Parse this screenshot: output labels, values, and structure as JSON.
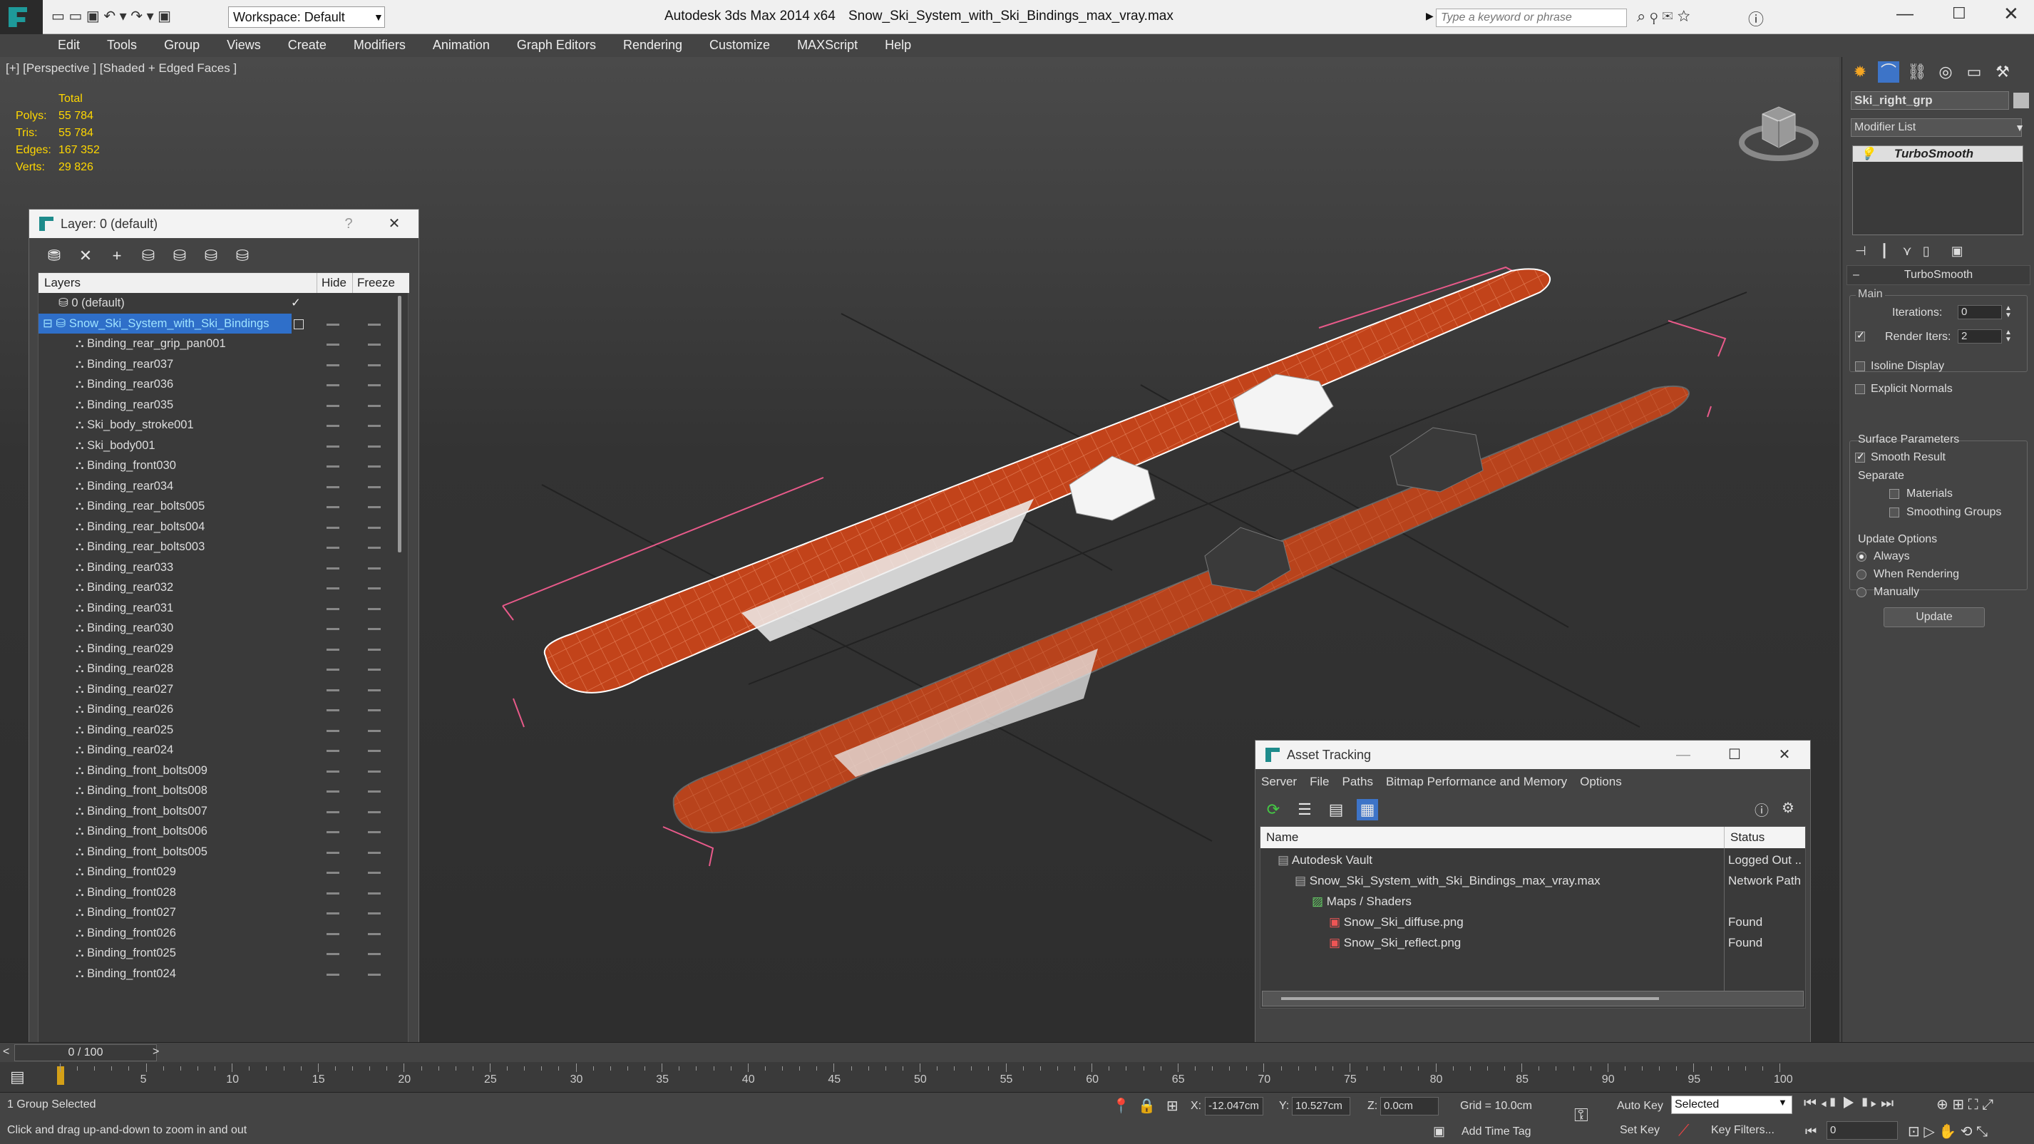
{
  "app": {
    "title": "Autodesk 3ds Max  2014 x64",
    "file": "Snow_Ski_System_with_Ski_Bindings_max_vray.max",
    "workspace": "Workspace: Default",
    "search_placeholder": "Type a keyword or phrase"
  },
  "menu": [
    "Edit",
    "Tools",
    "Group",
    "Views",
    "Create",
    "Modifiers",
    "Animation",
    "Graph Editors",
    "Rendering",
    "Customize",
    "MAXScript",
    "Help"
  ],
  "viewport": {
    "label": "[+] [Perspective ] [Shaded + Edged Faces ]",
    "stats": {
      "header": "Total",
      "rows": [
        {
          "label": "Polys:",
          "value": "55 784"
        },
        {
          "label": "Tris:",
          "value": "55 784"
        },
        {
          "label": "Edges:",
          "value": "167 352"
        },
        {
          "label": "Verts:",
          "value": "29 826"
        }
      ]
    }
  },
  "layer_window": {
    "title": "Layer: 0 (default)",
    "help": "?",
    "col_layers": "Layers",
    "col_hide": "Hide",
    "col_freeze": "Freeze",
    "rows": [
      "0 (default)",
      "Snow_Ski_System_with_Ski_Bindings",
      "Binding_rear_grip_pan001",
      "Binding_rear037",
      "Binding_rear036",
      "Binding_rear035",
      "Ski_body_stroke001",
      "Ski_body001",
      "Binding_front030",
      "Binding_rear034",
      "Binding_rear_bolts005",
      "Binding_rear_bolts004",
      "Binding_rear_bolts003",
      "Binding_rear033",
      "Binding_rear032",
      "Binding_rear031",
      "Binding_rear030",
      "Binding_rear029",
      "Binding_rear028",
      "Binding_rear027",
      "Binding_rear026",
      "Binding_rear025",
      "Binding_rear024",
      "Binding_front_bolts009",
      "Binding_front_bolts008",
      "Binding_front_bolts007",
      "Binding_front_bolts006",
      "Binding_front_bolts005",
      "Binding_front029",
      "Binding_front028",
      "Binding_front027",
      "Binding_front026",
      "Binding_front025",
      "Binding_front024"
    ]
  },
  "command_panel": {
    "object_name": "Ski_right_grp",
    "modifier_list": "Modifier List",
    "stack_item": "TurboSmooth",
    "rollout_title": "TurboSmooth",
    "main": "Main",
    "iterations_label": "Iterations:",
    "iterations_value": "0",
    "render_iters_label": "Render Iters:",
    "render_iters_value": "2",
    "isoline": "Isoline Display",
    "explicit_normals": "Explicit Normals",
    "surface_params": "Surface Parameters",
    "smooth_result": "Smooth Result",
    "separate": "Separate",
    "materials": "Materials",
    "smoothing_groups": "Smoothing Groups",
    "update_options": "Update Options",
    "always": "Always",
    "when_rendering": "When Rendering",
    "manually": "Manually",
    "update_btn": "Update"
  },
  "asset_tracking": {
    "title": "Asset Tracking",
    "menu": [
      "Server",
      "File",
      "Paths",
      "Bitmap Performance and Memory",
      "Options"
    ],
    "col_name": "Name",
    "col_status": "Status",
    "rows": [
      {
        "name": "Autodesk Vault",
        "status": "Logged Out ..",
        "indent": 1
      },
      {
        "name": "Snow_Ski_System_with_Ski_Bindings_max_vray.max",
        "status": "Network Path",
        "indent": 2
      },
      {
        "name": "Maps / Shaders",
        "status": "",
        "indent": 3
      },
      {
        "name": "Snow_Ski_diffuse.png",
        "status": "Found",
        "indent": 4
      },
      {
        "name": "Snow_Ski_reflect.png",
        "status": "Found",
        "indent": 4
      }
    ]
  },
  "timeline": {
    "frame": "0 / 100",
    "ticks": [
      "0",
      "5",
      "10",
      "15",
      "20",
      "25",
      "30",
      "35",
      "40",
      "45",
      "50",
      "55",
      "60",
      "65",
      "70",
      "75",
      "80",
      "85",
      "90",
      "95",
      "100"
    ]
  },
  "status": {
    "selection": "1 Group Selected",
    "prompt": "Click and drag up-and-down to zoom in and out",
    "x_label": "X:",
    "x_value": "-12.047cm",
    "y_label": "Y:",
    "y_value": "10.527cm",
    "z_label": "Z:",
    "z_value": "0.0cm",
    "grid": "Grid = 10.0cm",
    "auto_key": "Auto Key",
    "selected": "Selected",
    "set_key": "Set Key",
    "key_filters": "Key Filters...",
    "add_time_tag": "Add Time Tag",
    "current_frame": "0"
  }
}
